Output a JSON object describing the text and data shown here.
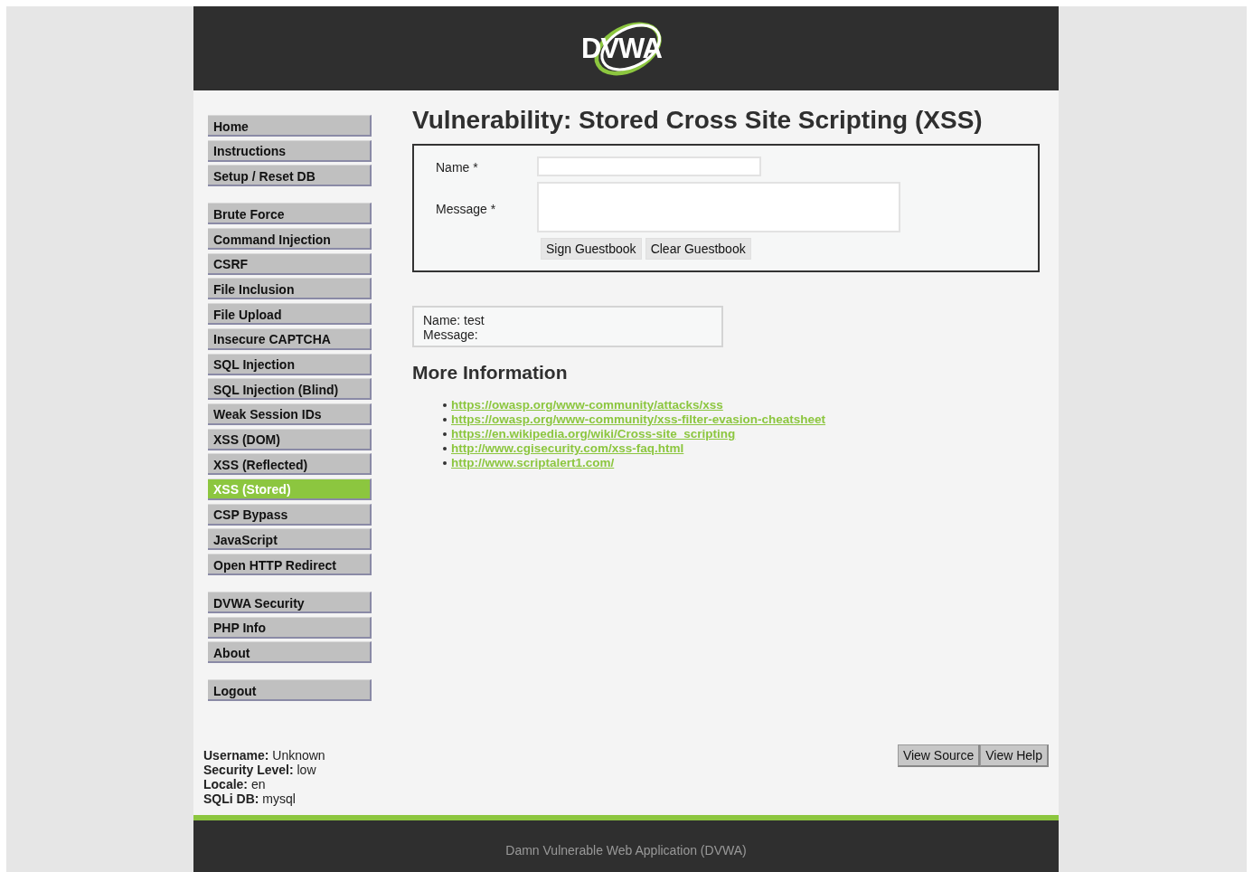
{
  "header": {
    "logo": "DVWA"
  },
  "menu": [
    {
      "items": [
        {
          "label": "Home",
          "selected": false
        },
        {
          "label": "Instructions",
          "selected": false
        },
        {
          "label": "Setup / Reset DB",
          "selected": false
        }
      ]
    },
    {
      "items": [
        {
          "label": "Brute Force",
          "selected": false
        },
        {
          "label": "Command Injection",
          "selected": false
        },
        {
          "label": "CSRF",
          "selected": false
        },
        {
          "label": "File Inclusion",
          "selected": false
        },
        {
          "label": "File Upload",
          "selected": false
        },
        {
          "label": "Insecure CAPTCHA",
          "selected": false
        },
        {
          "label": "SQL Injection",
          "selected": false
        },
        {
          "label": "SQL Injection (Blind)",
          "selected": false
        },
        {
          "label": "Weak Session IDs",
          "selected": false
        },
        {
          "label": "XSS (DOM)",
          "selected": false
        },
        {
          "label": "XSS (Reflected)",
          "selected": false
        },
        {
          "label": "XSS (Stored)",
          "selected": true
        },
        {
          "label": "CSP Bypass",
          "selected": false
        },
        {
          "label": "JavaScript",
          "selected": false
        },
        {
          "label": "Open HTTP Redirect",
          "selected": false
        }
      ]
    },
    {
      "items": [
        {
          "label": "DVWA Security",
          "selected": false
        },
        {
          "label": "PHP Info",
          "selected": false
        },
        {
          "label": "About",
          "selected": false
        }
      ]
    },
    {
      "items": [
        {
          "label": "Logout",
          "selected": false
        }
      ]
    }
  ],
  "title": "Vulnerability: Stored Cross Site Scripting (XSS)",
  "form": {
    "name_label": "Name *",
    "message_label": "Message *",
    "buttons": [
      "Sign Guestbook",
      "Clear Guestbook"
    ]
  },
  "guestbook": [
    {
      "lines": [
        "Name: test",
        "Message:"
      ]
    }
  ],
  "more_info": {
    "heading": "More Information",
    "links": [
      "https://owasp.org/www-community/attacks/xss",
      "https://owasp.org/www-community/xss-filter-evasion-cheatsheet",
      "https://en.wikipedia.org/wiki/Cross-site_scripting",
      "http://www.cgisecurity.com/xss-faq.html",
      "http://www.scriptalert1.com/"
    ]
  },
  "status": [
    "**Username:** Unknown",
    "**Security Level:** low",
    "**Locale:** en",
    "**SQLi DB:** mysql"
  ],
  "page_buttons": [
    "View Source",
    "View Help"
  ],
  "footer": "Damn Vulnerable Web Application (DVWA)"
}
